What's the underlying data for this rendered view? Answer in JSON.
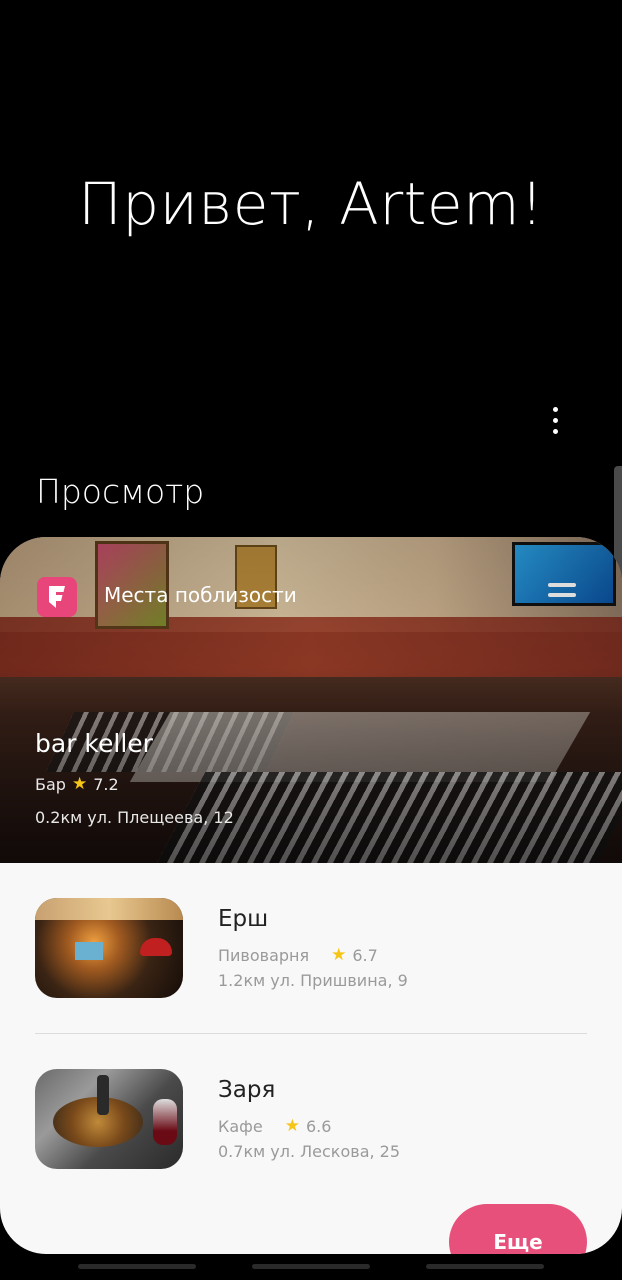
{
  "greeting": "Привет, Artem!",
  "section_title": "Просмотр",
  "card": {
    "provider_label": "Места поблизости",
    "provider_icon": "foursquare-icon",
    "featured": {
      "name": "bar keller",
      "category": "Бар",
      "rating": "7.2",
      "address": "0.2км ул. Плещеева, 12"
    },
    "items": [
      {
        "name": "Ерш",
        "category": "Пивоварня",
        "rating": "6.7",
        "address": "1.2км ул. Пришвина, 9"
      },
      {
        "name": "Заря",
        "category": "Кафе",
        "rating": "6.6",
        "address": "0.7км ул. Лескова, 25"
      }
    ],
    "more_label": "Еще"
  },
  "colors": {
    "accent": "#e8507c",
    "star": "#f5c518",
    "background": "#000000",
    "card": "#f8f8f8"
  }
}
